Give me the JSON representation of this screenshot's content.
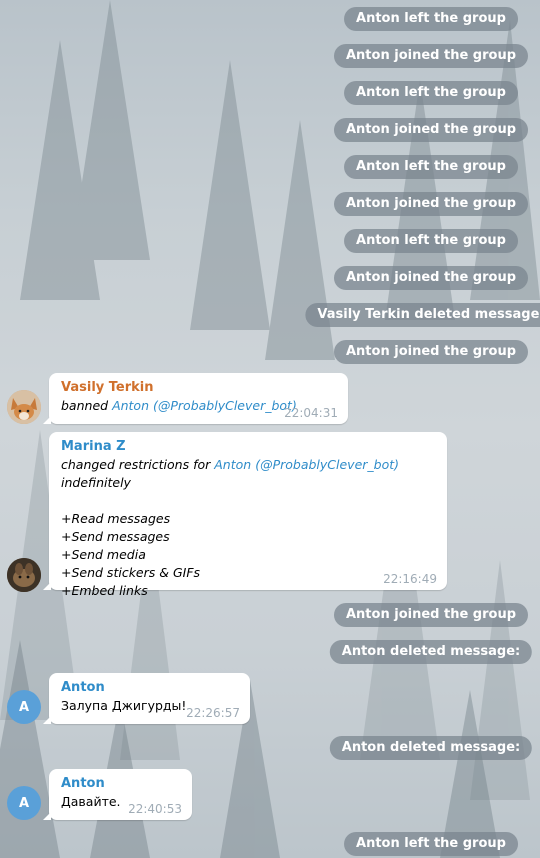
{
  "service_messages": [
    "Anton left the group",
    "Anton joined the group",
    "Anton left the group",
    "Anton joined the group",
    "Anton left the group",
    "Anton joined the group",
    "Anton left the group",
    "Anton joined the group",
    "Vasily Terkin deleted message:",
    "Anton joined the group",
    "Anton joined the group",
    "Anton deleted message:",
    "Anton deleted message:",
    "Anton left the group"
  ],
  "messages": [
    {
      "sender": "Vasily Terkin",
      "sender_color": "#d0702c",
      "action": "banned",
      "user": "Anton",
      "username": "(@ProbablyClever_bot)",
      "time": "22:04:31"
    },
    {
      "sender": "Marina Z",
      "sender_color": "#2f8cc9",
      "action": "changed restrictions for",
      "user": "Anton",
      "username": "(@ProbablyClever_bot)",
      "suffix": "indefinitely",
      "permissions": [
        "+Read messages",
        "+Send messages",
        "+Send media",
        "+Send stickers & GIFs",
        "+Embed links"
      ],
      "time": "22:16:49"
    },
    {
      "sender": "Anton",
      "sender_color": "#2f8cc9",
      "text": "Залупа Джигурды!",
      "time": "22:26:57",
      "avatar_letter": "A",
      "avatar_color": "#5aa0d8"
    },
    {
      "sender": "Anton",
      "sender_color": "#2f8cc9",
      "text": "Давайте.",
      "time": "22:40:53",
      "avatar_letter": "A",
      "avatar_color": "#5aa0d8"
    }
  ]
}
